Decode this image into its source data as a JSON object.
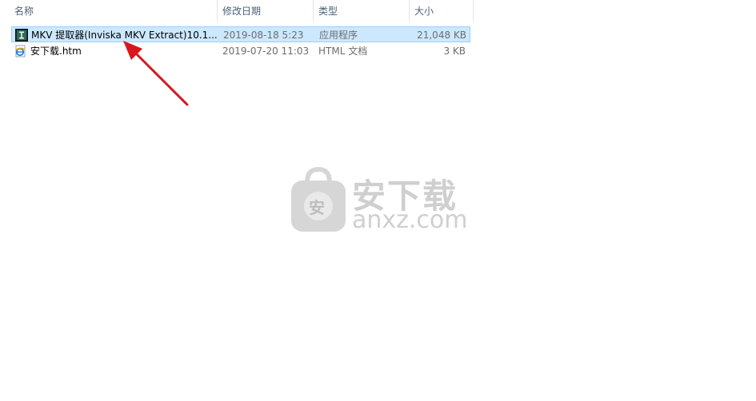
{
  "columns": {
    "name": "名称",
    "date": "修改日期",
    "type": "类型",
    "size": "大小"
  },
  "files": [
    {
      "name": "MKV 提取器(Inviska MKV Extract)10.1...",
      "date": "2019-08-18 5:23",
      "type": "应用程序",
      "size": "21,048 KB",
      "icon": "mkv-extract-app-icon",
      "selected": true
    },
    {
      "name": "安下载.htm",
      "date": "2019-07-20 11:03",
      "type": "HTML 文档",
      "size": "3 KB",
      "icon": "ie-html-icon",
      "selected": false
    }
  ],
  "watermark": {
    "title": "安下载",
    "domain": "anxz.com",
    "badge": "安"
  },
  "colors": {
    "selection_bg": "#cce8ff",
    "selection_border": "#99d1ff",
    "header_text": "#4c607a",
    "arrow": "#d9161c",
    "watermark": "#cfcfcf"
  }
}
